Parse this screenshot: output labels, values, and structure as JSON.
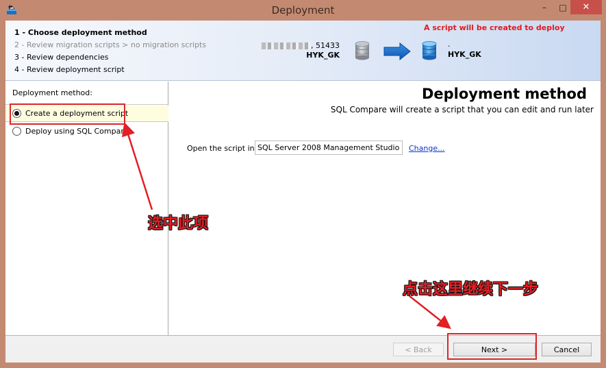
{
  "window": {
    "title": "Deployment",
    "controls": {
      "minimize": "–",
      "maximize": "□",
      "close": "✕"
    }
  },
  "header": {
    "steps": [
      {
        "label": "1 - Choose deployment method",
        "state": "active"
      },
      {
        "label": "2 - Review migration scripts > no migration scripts",
        "state": "disabled"
      },
      {
        "label": "3 - Review dependencies",
        "state": "normal"
      },
      {
        "label": "4 - Review deployment script",
        "state": "normal"
      }
    ],
    "source": {
      "server_suffix": ", 51433",
      "database": "HYK_GK",
      "icon": "database-gray-icon"
    },
    "direction_icon": "right-arrow-icon",
    "target": {
      "server": ".",
      "database": "HYK_GK",
      "icon": "database-blue-icon"
    },
    "notice": "A script will be created to deploy"
  },
  "left_panel": {
    "label": "Deployment method:",
    "options": [
      {
        "label": "Create a deployment script",
        "selected": true
      },
      {
        "label": "Deploy using SQL Compare",
        "selected": false
      }
    ]
  },
  "main": {
    "title": "Deployment method",
    "subtitle": "SQL Compare will create a script that you can edit and run later",
    "open_in_label": "Open the script in:",
    "open_in_value": "SQL Server 2008 Management Studio",
    "change_link": "Change..."
  },
  "footer": {
    "back": "< Back",
    "next": "Next >",
    "cancel": "Cancel"
  },
  "annotations": {
    "select_option": "选中此项",
    "click_next": "点击这里继续下一步",
    "color": "#e11f24"
  }
}
